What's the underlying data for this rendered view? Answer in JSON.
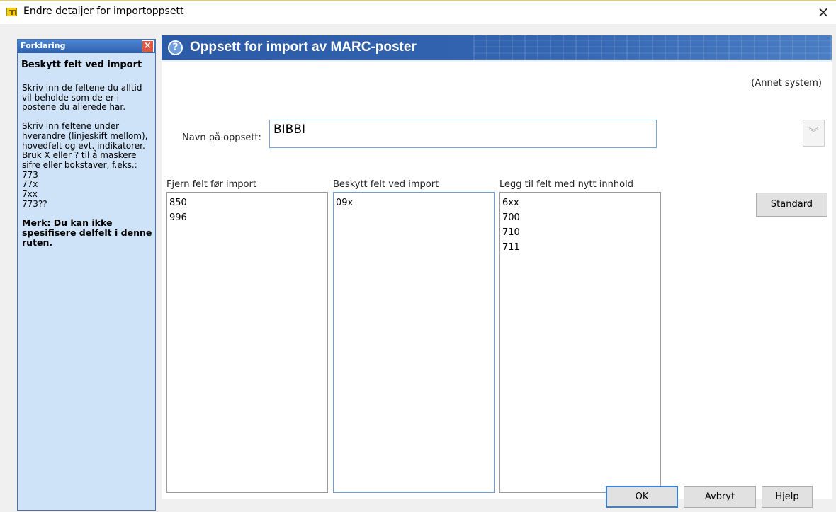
{
  "window": {
    "title": "Endre detaljer for importoppsett",
    "close_glyph": "×"
  },
  "help": {
    "header": "Forklaring",
    "close_glyph": "×",
    "title": "Beskytt felt ved import",
    "paragraph1": "Skriv inn de feltene du alltid vil beholde som de er i postene du allerede har.",
    "paragraph2": "Skriv inn feltene under hverandre (linjeskift mellom), hovedfelt og evt. indikatorer. Bruk X eller ? til å maskere sifre eller bokstaver, f.eks.:",
    "examples": [
      "773",
      "77x",
      "7xx",
      "773??"
    ],
    "note": "Merk: Du kan ikke spesifisere delfelt i denne ruten."
  },
  "banner": {
    "icon": "question-circle-icon",
    "title": "Oppsett for import av MARC-poster"
  },
  "form": {
    "system_label": "(Annet system)",
    "name_label": "Navn på oppsett:",
    "name_value": "BIBBI",
    "dropdown_icon": "double-chevron-down-icon",
    "dropdown_glyph": "︾"
  },
  "columns": [
    {
      "label": "Fjern felt før import",
      "entries": [
        "850",
        "996"
      ]
    },
    {
      "label": "Beskytt felt ved import",
      "entries": [
        "09x"
      ]
    },
    {
      "label": "Legg til felt med nytt innhold",
      "entries": [
        "6xx",
        "700",
        "710",
        "711"
      ]
    }
  ],
  "buttons": {
    "standard": "Standard",
    "ok": "OK",
    "cancel": "Avbryt",
    "help": "Hjelp"
  },
  "colors": {
    "banner_blue": "#3466b2",
    "help_panel_bg": "#cfe3f8",
    "focus_border": "#3b7fd4"
  }
}
